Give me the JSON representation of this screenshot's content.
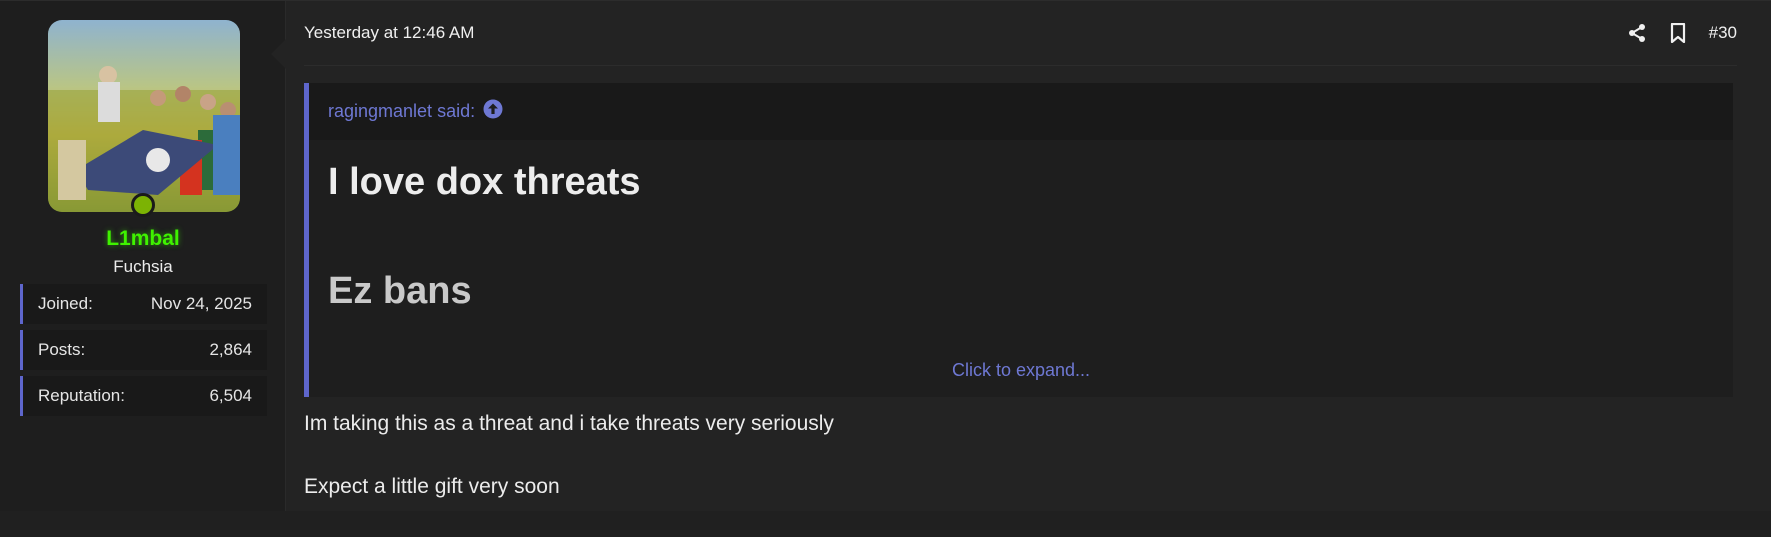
{
  "user": {
    "username": "L1mbal",
    "title": "Fuchsia",
    "online": true,
    "stats": [
      {
        "label": "Joined:",
        "value": "Nov 24, 2025"
      },
      {
        "label": "Posts:",
        "value": "2,864"
      },
      {
        "label": "Reputation:",
        "value": "6,504"
      }
    ]
  },
  "post": {
    "date": "Yesterday at 12:46 AM",
    "number": "#30",
    "actions": {
      "share_icon": "share-icon",
      "bookmark_icon": "bookmark-icon"
    }
  },
  "quote": {
    "attribution": "ragingmanlet said:",
    "jump_icon": "arrow-up-circle-icon",
    "line1": "I love dox threats",
    "line2": "Ez bans",
    "expand_label": "Click to expand..."
  },
  "message": {
    "paragraphs": [
      "Im taking this as a threat and i take threats very seriously",
      "Expect a little gift very soon"
    ]
  },
  "colors": {
    "accent": "#5e66cc",
    "username": "#3ff200",
    "online": "#7cb304",
    "background": "#232323"
  }
}
